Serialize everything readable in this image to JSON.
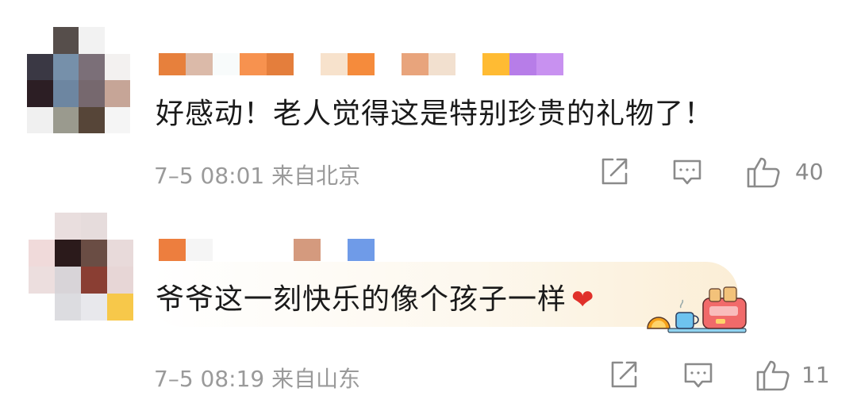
{
  "comments": [
    {
      "avatar": {
        "pixels": [
          "#ffffff",
          "#564e4b",
          "#f2f2f2",
          "#ffffff",
          "#3a3844",
          "#7690aa",
          "#7b6f78",
          "#f3f1f0",
          "#2c1e24",
          "#6d86a1",
          "#76686e",
          "#c6a597",
          "#f0f0f0",
          "#9a9a8e",
          "#564538",
          "#f5f5f5"
        ]
      },
      "username_blocks": [
        "#e7803c",
        "#dbbaa9",
        "#f8fbfb",
        "#f7924f",
        "#e47e3c",
        "#ffffff",
        "#f7e2cc",
        "#f58b3c",
        "#ffffff",
        "#e8a47c",
        "#f2e0cf",
        "#ffffff",
        "#ffbb33",
        "#b77de8",
        "#c891f0"
      ],
      "text": "好感动！老人觉得这是特别珍贵的礼物了！",
      "time": "7–5 08:01",
      "location": "来自北京",
      "likes": "40"
    },
    {
      "avatar": {
        "pixels": [
          "#ffffff",
          "#e9dede",
          "#e6dcdc",
          "#ffffff",
          "#f0dada",
          "#2b1a1b",
          "#6a4d44",
          "#e8dada",
          "#ecdede",
          "#d8d4d8",
          "#8a3e33",
          "#e7d6d6",
          "#ffffff",
          "#dcdce0",
          "#e8e8ec",
          "#f7c84a"
        ]
      },
      "username_blocks": [
        "#ed7e3e",
        "#f5f5f5",
        "#ffffff",
        "#ffffff",
        "#ffffff",
        "#d49a7e",
        "#ffffff",
        "#6f9be8",
        "#ffffff"
      ],
      "text": "爷爷这一刻快乐的像个孩子一样",
      "heart": "❤",
      "time": "7–5 08:19",
      "location": "来自山东",
      "likes": "11"
    }
  ],
  "icons": {
    "share": "share-icon",
    "reply": "comment-icon",
    "like": "thumbs-up-icon"
  },
  "colors": {
    "text": "#1a1a1a",
    "meta": "#9a9a9a",
    "icon": "#8a8a8a",
    "heart": "#e0302a"
  }
}
